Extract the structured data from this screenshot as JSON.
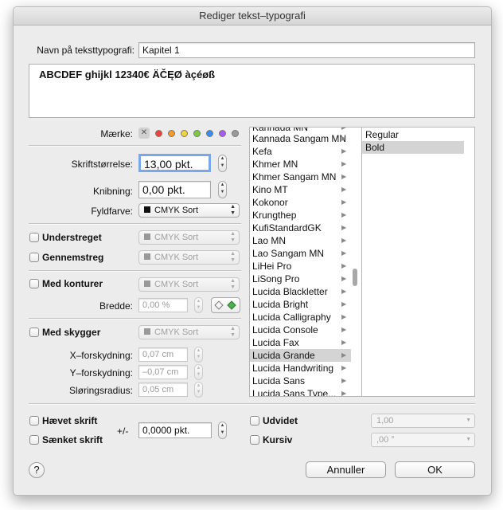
{
  "window": {
    "title": "Rediger tekst–typografi"
  },
  "name_row": {
    "label": "Navn på teksttypografi:",
    "value": "Kapitel 1"
  },
  "preview": {
    "text": "ABCDEF ghijkl 12340€ ÄČĘØ àçéøß"
  },
  "marke": {
    "label": "Mærke:",
    "clear_glyph": "✕",
    "colors": [
      "#e8453c",
      "#f29b30",
      "#f2d53c",
      "#7ac943",
      "#3c8de8",
      "#a35de8",
      "#9a9a9a"
    ]
  },
  "font_size": {
    "label": "Skriftstørrelse:",
    "value": "13,00 pkt."
  },
  "kerning": {
    "label": "Knibning:",
    "value": "0,00 pkt."
  },
  "fill": {
    "label": "Fyldfarve:",
    "value": "CMYK Sort"
  },
  "underline": {
    "label": "Understreget",
    "color": "CMYK Sort"
  },
  "strikethrough": {
    "label": "Gennemstreg",
    "color": "CMYK Sort"
  },
  "outline": {
    "label": "Med konturer",
    "color": "CMYK Sort",
    "width_label": "Bredde:",
    "width_value": "0,00 %"
  },
  "shadow": {
    "label": "Med skygger",
    "color": "CMYK Sort",
    "x_label": "X–forskydning:",
    "x_value": "0,07 cm",
    "y_label": "Y–forskydning:",
    "y_value": "–0,07 cm",
    "blur_label": "Sløringsradius:",
    "blur_value": "0,05 cm"
  },
  "fonts": {
    "partial_top": "Kannada MN",
    "items": [
      "Kannada Sangam MN",
      "Kefa",
      "Khmer MN",
      "Khmer Sangam MN",
      "Kino MT",
      "Kokonor",
      "Krungthep",
      "KufiStandardGK",
      "Lao MN",
      "Lao Sangam MN",
      "LiHei Pro",
      "LiSong Pro",
      "Lucida Blackletter",
      "Lucida Bright",
      "Lucida Calligraphy",
      "Lucida Console",
      "Lucida Fax",
      "Lucida Grande",
      "Lucida Handwriting",
      "Lucida Sans",
      "Lucida Sans Type..."
    ],
    "selected": "Lucida Grande"
  },
  "styles": {
    "items": [
      "Regular",
      "Bold"
    ],
    "selected": "Bold"
  },
  "superscript": {
    "label": "Hævet skrift"
  },
  "subscript": {
    "label": "Sænket skrift"
  },
  "offset": {
    "label": "+/-",
    "value": "0,0000 pkt."
  },
  "expanded": {
    "label": "Udvidet",
    "value": "1,00"
  },
  "italic": {
    "label": "Kursiv",
    "value": ",00 °"
  },
  "help": {
    "label": "?"
  },
  "buttons": {
    "cancel": "Annuller",
    "ok": "OK"
  }
}
